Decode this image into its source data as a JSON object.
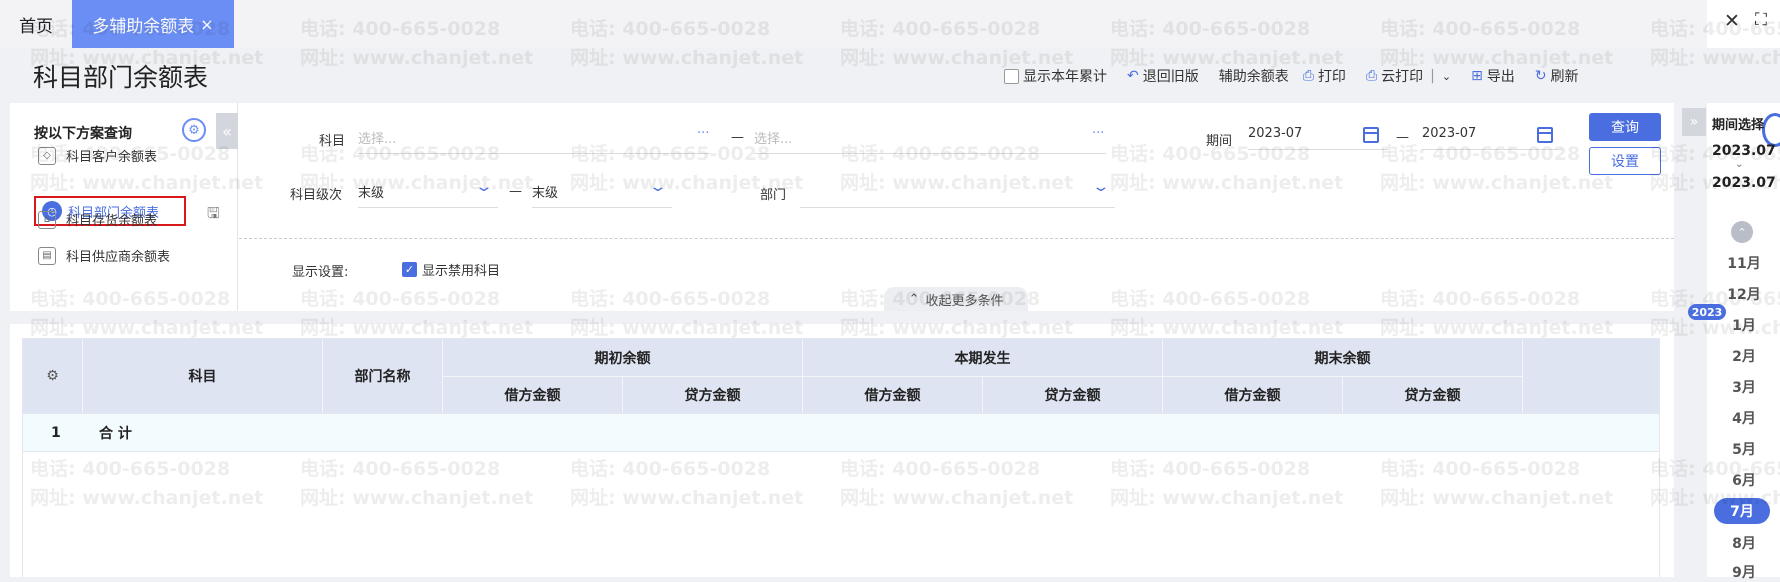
{
  "tabs": {
    "home": "首页",
    "active": "多辅助余额表",
    "close_glyph": "×"
  },
  "window": {
    "close_glyph": "✕",
    "fullscreen_glyph": "⛶"
  },
  "page": {
    "title": "科目部门余额表"
  },
  "toolbar": {
    "show_year_total": "显示本年累计",
    "revert_old": "退回旧版",
    "aux_balance": "辅助余额表",
    "print": "打印",
    "cloud_print": "云打印",
    "separator": "|",
    "export": "导出",
    "refresh": "刷新"
  },
  "scheme": {
    "title": "按以下方案查询",
    "items": [
      {
        "label": "科目客户余额表",
        "icon": "cube-icon"
      },
      {
        "label": "科目部门余额表",
        "icon": "clock-icon",
        "active": true
      },
      {
        "label": "科目存货余额表",
        "icon": "warehouse-icon"
      },
      {
        "label": "科目供应商余额表",
        "icon": "card-icon"
      }
    ]
  },
  "filters": {
    "subject_label": "科目",
    "subject_from_placeholder": "选择...",
    "subject_to_placeholder": "选择...",
    "dash": "—",
    "period_label": "期间",
    "period_from": "2023-07",
    "period_to": "2023-07",
    "level_label": "科目级次",
    "level_from": "末级",
    "level_to": "末级",
    "dept_label": "部门",
    "dept_value": "",
    "display_label": "显示设置:",
    "show_disabled": "显示禁用科目",
    "collapse_more": "收起更多条件",
    "query_button": "查询",
    "settings_button": "设置"
  },
  "table": {
    "col_subject": "科目",
    "col_dept": "部门名称",
    "groups": [
      "期初余额",
      "本期发生",
      "期末余额"
    ],
    "debit": "借方金额",
    "credit": "贷方金额",
    "rows": [
      {
        "index": "1",
        "name": "合 计"
      }
    ]
  },
  "period_panel": {
    "title": "期间选择",
    "from": "2023.07",
    "to": "2023.07",
    "year_badge": "2023",
    "months": [
      "11月",
      "12月",
      "1月",
      "2月",
      "3月",
      "4月",
      "5月",
      "6月",
      "7月",
      "8月",
      "9月"
    ],
    "active_month": "7月"
  },
  "watermark": {
    "phone": "电话: 400-665-0028",
    "site": "网址: www.chanjet.net"
  },
  "colors": {
    "accent": "#4a6ee0",
    "tab_active": "#6b8ef5",
    "highlight_border": "#d7191c",
    "table_header": "#dfe4f2"
  }
}
